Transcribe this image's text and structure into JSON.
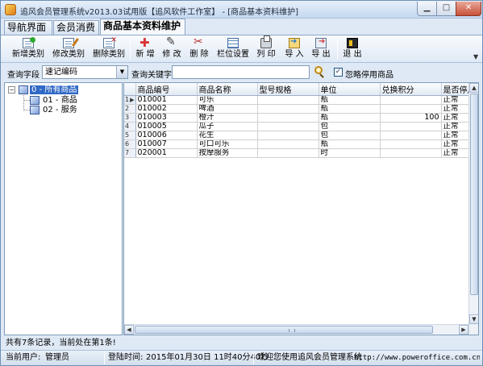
{
  "window": {
    "title": "追风会员管理系统v2013.03试用版【追风软件工作室】 - [商品基本资料维护]",
    "min_glyph": "▁",
    "max_glyph": "□",
    "close_glyph": "✕"
  },
  "tabs": [
    {
      "label": "导航界面"
    },
    {
      "label": "会员消费"
    },
    {
      "label": "商品基本资料维护",
      "active": true
    }
  ],
  "toolbar": {
    "items": [
      {
        "label": "新增类别",
        "icon": "add-category-icon"
      },
      {
        "label": "修改类别",
        "icon": "edit-category-icon"
      },
      {
        "label": "删除类别",
        "icon": "delete-category-icon"
      },
      {
        "label": "新 增",
        "icon": "add-icon"
      },
      {
        "label": "修 改",
        "icon": "edit-icon"
      },
      {
        "label": "删 除",
        "icon": "delete-icon"
      },
      {
        "label": "栏位设置",
        "icon": "column-settings-icon"
      },
      {
        "label": "列 印",
        "icon": "print-icon"
      },
      {
        "label": "导 入",
        "icon": "import-icon"
      },
      {
        "label": "导 出",
        "icon": "export-icon"
      },
      {
        "label": "退 出",
        "icon": "exit-icon"
      }
    ],
    "overflow_glyph": "▼"
  },
  "query": {
    "field_label": "查询字段",
    "field_value": "速记编码",
    "keyword_label": "查询关键字",
    "keyword_value": "",
    "ignore_disabled_label": "忽略停用商品",
    "ignore_disabled_checked": true,
    "check_glyph": "✓",
    "dropdown_glyph": "▼"
  },
  "tree": {
    "nodes": [
      {
        "label": "0 - 所有商品",
        "selected": true,
        "expanded": true
      },
      {
        "label": "01 - 商品"
      },
      {
        "label": "02 - 服务"
      }
    ],
    "collapse_glyph": "−"
  },
  "grid": {
    "columns": [
      "商品编号",
      "商品名称",
      "型号规格",
      "单位",
      "兑换积分",
      "是否停用"
    ],
    "rows": [
      {
        "num": "1",
        "code": "010001",
        "name": "可乐",
        "spec": "",
        "unit": "瓶",
        "points": "",
        "disabled": "正常"
      },
      {
        "num": "2",
        "code": "010002",
        "name": "啤酒",
        "spec": "",
        "unit": "瓶",
        "points": "",
        "disabled": "正常"
      },
      {
        "num": "3",
        "code": "010003",
        "name": "橙汁",
        "spec": "",
        "unit": "瓶",
        "points": "100",
        "disabled": "正常"
      },
      {
        "num": "4",
        "code": "010005",
        "name": "瓜子",
        "spec": "",
        "unit": "包",
        "points": "",
        "disabled": "正常"
      },
      {
        "num": "5",
        "code": "010006",
        "name": "花生",
        "spec": "",
        "unit": "包",
        "points": "",
        "disabled": "正常"
      },
      {
        "num": "6",
        "code": "010007",
        "name": "可口可乐",
        "spec": "",
        "unit": "瓶",
        "points": "",
        "disabled": "正常"
      },
      {
        "num": "7",
        "code": "020001",
        "name": "按摩服务",
        "spec": "",
        "unit": "时",
        "points": "",
        "disabled": "正常"
      }
    ],
    "current_row_glyph": "▶",
    "scroll_up": "▲",
    "scroll_down": "▼",
    "scroll_left": "◀",
    "scroll_right": "▶"
  },
  "record_status": "共有7条记录，当前处在第1条!",
  "statusbar": {
    "user_label": "当前用户:",
    "user_value": "管理员",
    "login_label": "登陆时间:",
    "login_value": "2015年01月30日 11时40分40秒",
    "welcome": "欢迎您使用追风会员管理系统",
    "url": "http://www.poweroffice.com.cn Q"
  },
  "colors": {
    "accent": "#3169c6",
    "chrome": "#dfe9f5"
  }
}
